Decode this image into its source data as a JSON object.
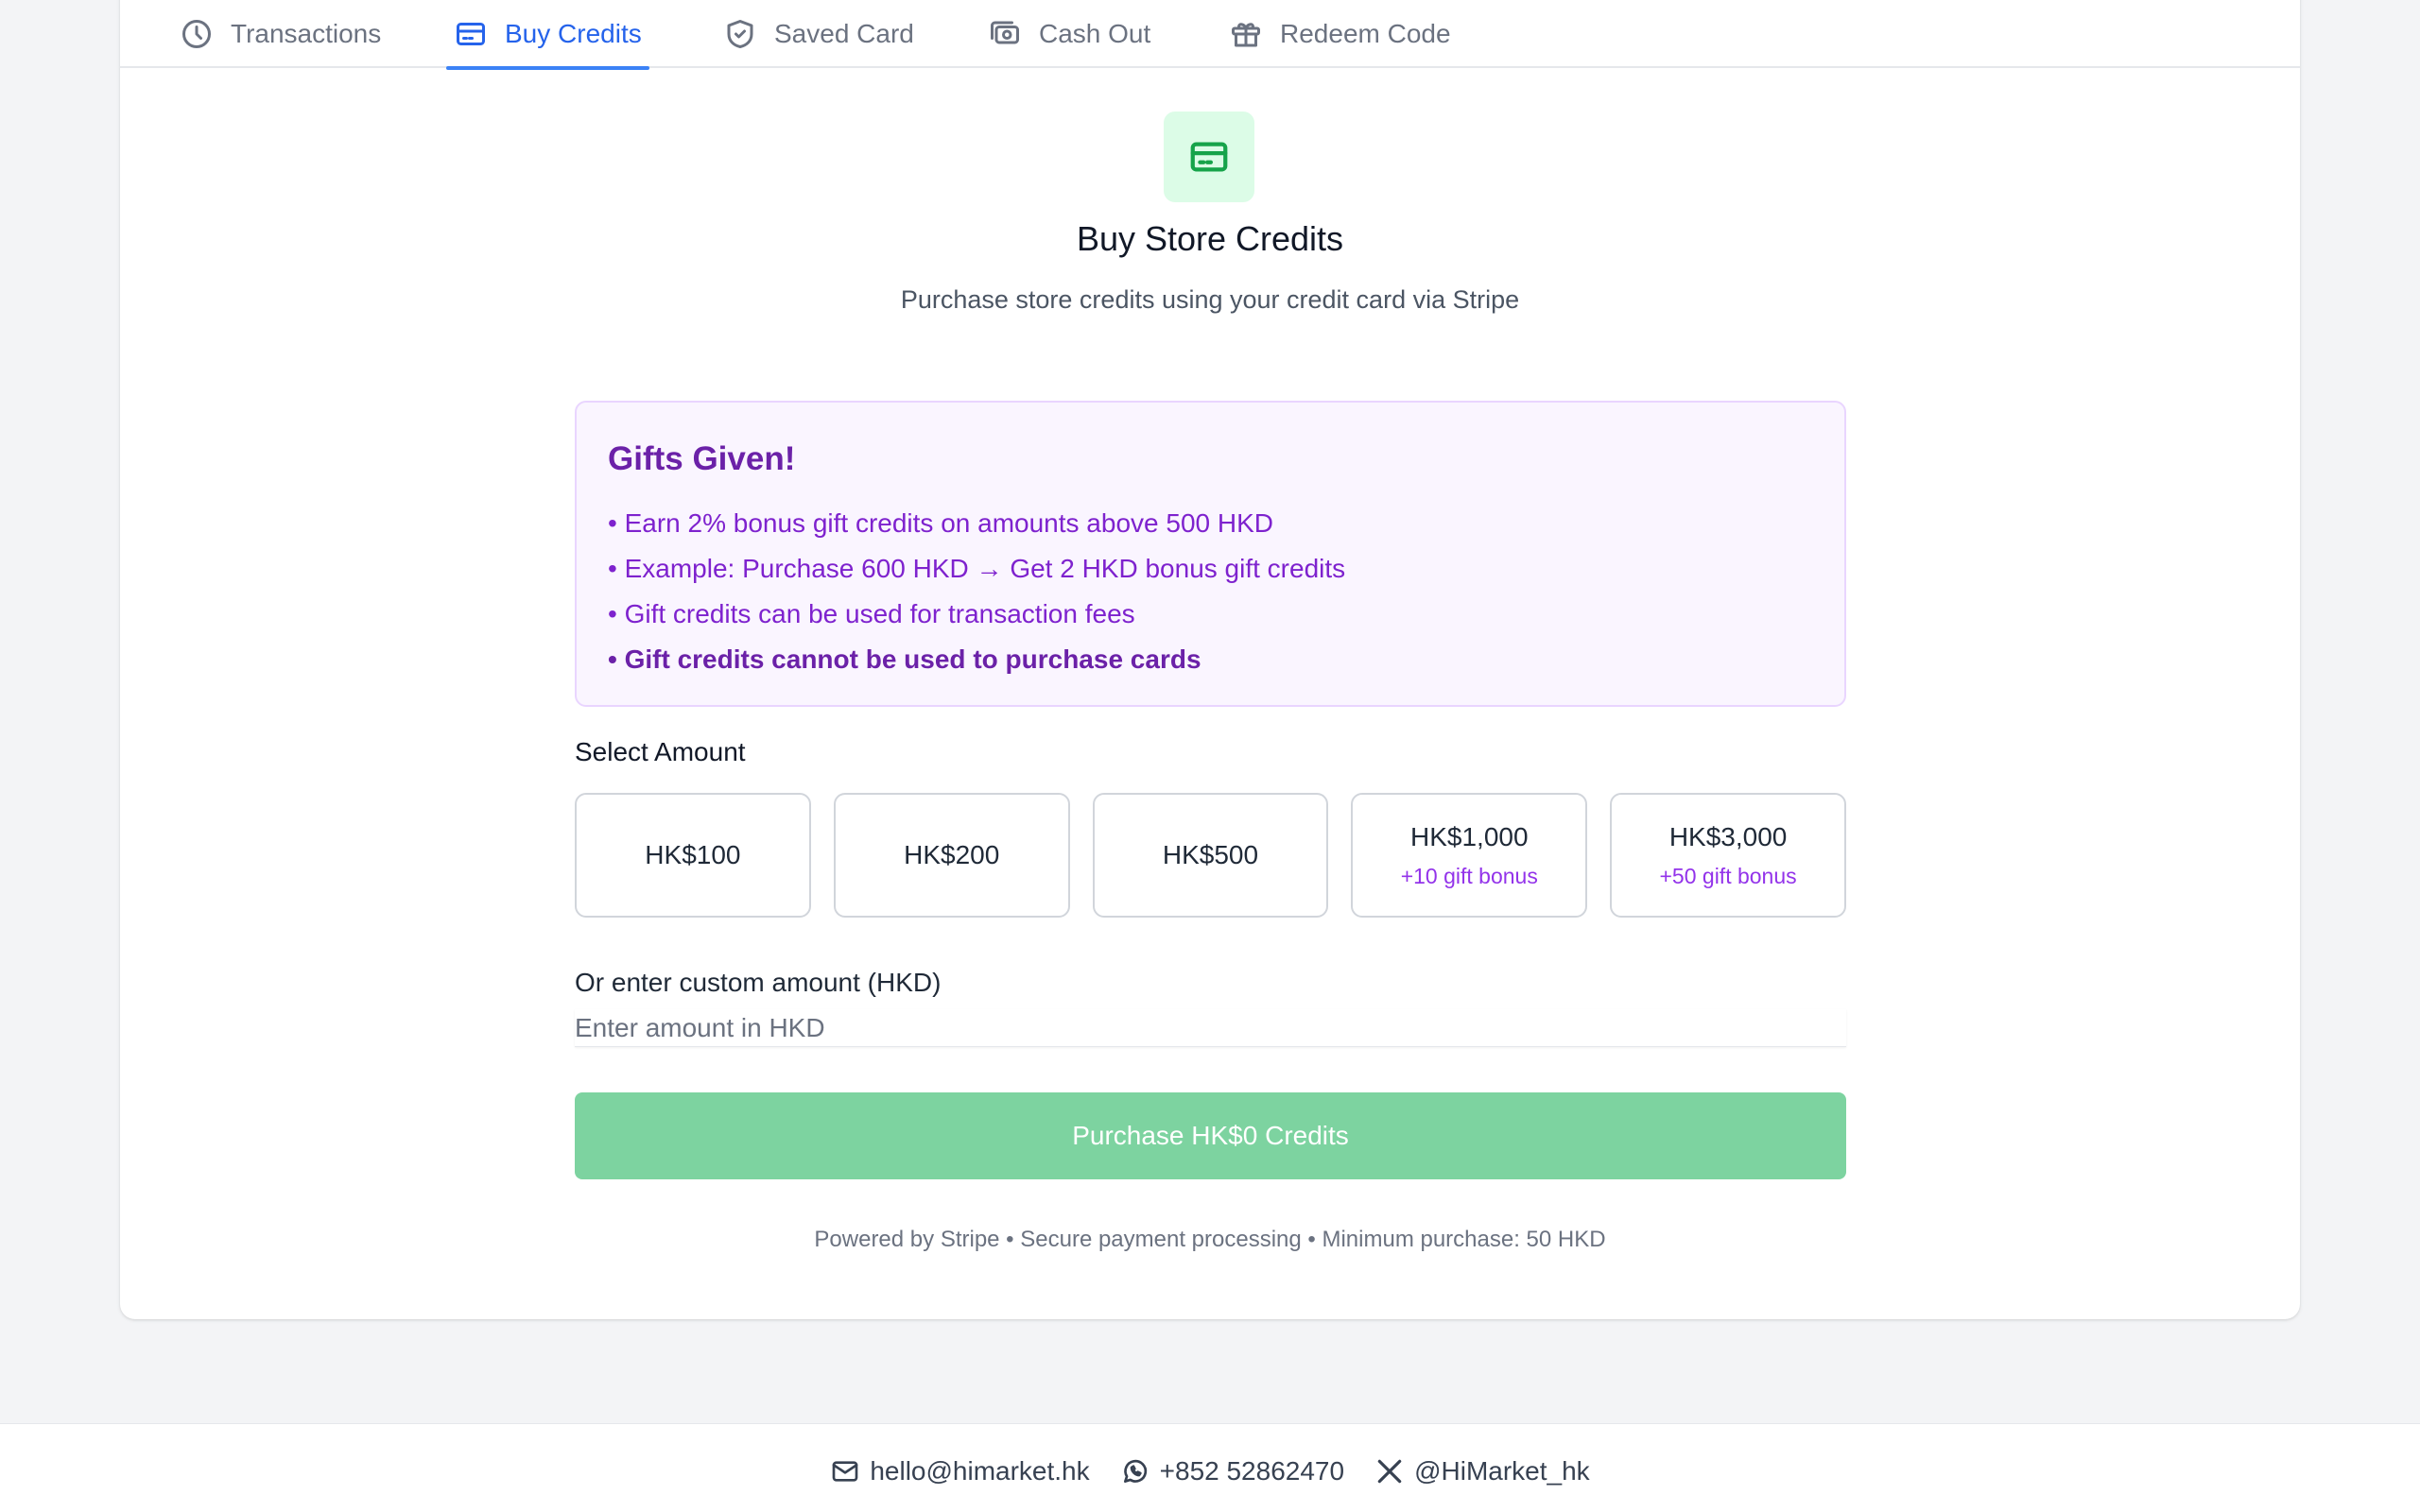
{
  "tabs": [
    {
      "label": "Transactions",
      "icon": "clock-icon",
      "active": false
    },
    {
      "label": "Buy Credits",
      "icon": "credit-card-icon",
      "active": true
    },
    {
      "label": "Saved Card",
      "icon": "shield-check-icon",
      "active": false
    },
    {
      "label": "Cash Out",
      "icon": "cash-icon",
      "active": false
    },
    {
      "label": "Redeem Code",
      "icon": "gift-icon",
      "active": false
    }
  ],
  "header": {
    "icon": "credit-card-icon",
    "title": "Buy Store Credits",
    "subtitle": "Purchase store credits using your credit card via Stripe"
  },
  "gifts": {
    "title": "Gifts Given!",
    "lines": [
      "• Earn 2% bonus gift credits on amounts above 500 HKD",
      "• Example: Purchase 600 HKD → Get 2 HKD bonus gift credits",
      "• Gift credits can be used for transaction fees",
      "• Gift credits cannot be used to purchase cards"
    ]
  },
  "amounts": {
    "label": "Select Amount",
    "options": [
      {
        "value": "HK$100",
        "bonus": ""
      },
      {
        "value": "HK$200",
        "bonus": ""
      },
      {
        "value": "HK$500",
        "bonus": ""
      },
      {
        "value": "HK$1,000",
        "bonus": "+10 gift bonus"
      },
      {
        "value": "HK$3,000",
        "bonus": "+50 gift bonus"
      }
    ]
  },
  "custom": {
    "label": "Or enter custom amount (HKD)",
    "placeholder": "Enter amount in HKD",
    "value": ""
  },
  "purchase": {
    "label": "Purchase HK$0 Credits"
  },
  "powered": "Powered by Stripe • Secure payment processing • Minimum purchase: 50 HKD",
  "footer": {
    "email": "hello@himarket.hk",
    "phone": "+852 52862470",
    "social": "@HiMarket_hk"
  },
  "colors": {
    "accent": "#2563eb",
    "success": "#16a34a",
    "purchase_button": "#7dd3a0",
    "gift_text": "#7e22ce"
  }
}
